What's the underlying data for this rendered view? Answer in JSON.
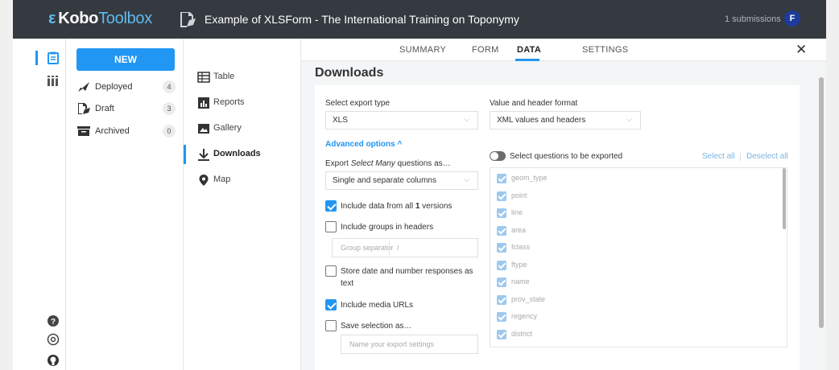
{
  "header": {
    "logo_kobo": "Kobo",
    "logo_toolbox": "Toolbox",
    "form_title": "Example of XLSForm - The International Training on Toponymy",
    "submissions": "1 submissions",
    "avatar_letter": "F"
  },
  "sidebar": {
    "new_label": "NEW",
    "items": [
      {
        "label": "Deployed",
        "count": "4",
        "icon": "rocket-icon"
      },
      {
        "label": "Draft",
        "count": "3",
        "icon": "draft-icon"
      },
      {
        "label": "Archived",
        "count": "0",
        "icon": "archive-icon"
      }
    ]
  },
  "submenu": {
    "items": [
      {
        "label": "Table",
        "icon": "table-icon"
      },
      {
        "label": "Reports",
        "icon": "reports-icon"
      },
      {
        "label": "Gallery",
        "icon": "gallery-icon"
      },
      {
        "label": "Downloads",
        "icon": "download-icon",
        "active": true
      },
      {
        "label": "Map",
        "icon": "map-pin-icon"
      }
    ]
  },
  "tabs": {
    "summary": "SUMMARY",
    "form": "FORM",
    "data": "DATA",
    "settings": "SETTINGS",
    "active": "DATA"
  },
  "downloads": {
    "title": "Downloads",
    "export_type_label": "Select export type",
    "export_type_value": "XLS",
    "format_label": "Value and header format",
    "format_value": "XML values and headers",
    "advanced_label": "Advanced options ^",
    "select_many_pre": "Export ",
    "select_many_em": "Select Many",
    "select_many_post": " questions as…",
    "select_many_value": "Single and separate columns",
    "include_all_versions_pre": "Include data from all ",
    "include_all_versions_num": "1",
    "include_all_versions_post": " versions",
    "include_all_versions_checked": true,
    "include_groups": "Include groups in headers",
    "include_groups_checked": false,
    "group_separator_label": "Group separator",
    "group_separator_value": "/",
    "store_date_line1": "Store date and number responses as",
    "store_date_line2": "text",
    "store_date_checked": false,
    "include_media": "Include media URLs",
    "include_media_checked": true,
    "save_selection": "Save selection as…",
    "save_selection_checked": false,
    "export_name_placeholder": "Name your export settings",
    "select_questions_label": "Select questions to be exported",
    "select_all": "Select all",
    "deselect_all": "Deselect all",
    "questions": [
      "geom_type",
      "point",
      "line",
      "area",
      "fclass",
      "ftype",
      "name",
      "prov_state",
      "regency",
      "district"
    ]
  },
  "colors": {
    "accent": "#2196f3",
    "header_bg": "#343a40",
    "avatar_bg": "#1c3b9a"
  }
}
